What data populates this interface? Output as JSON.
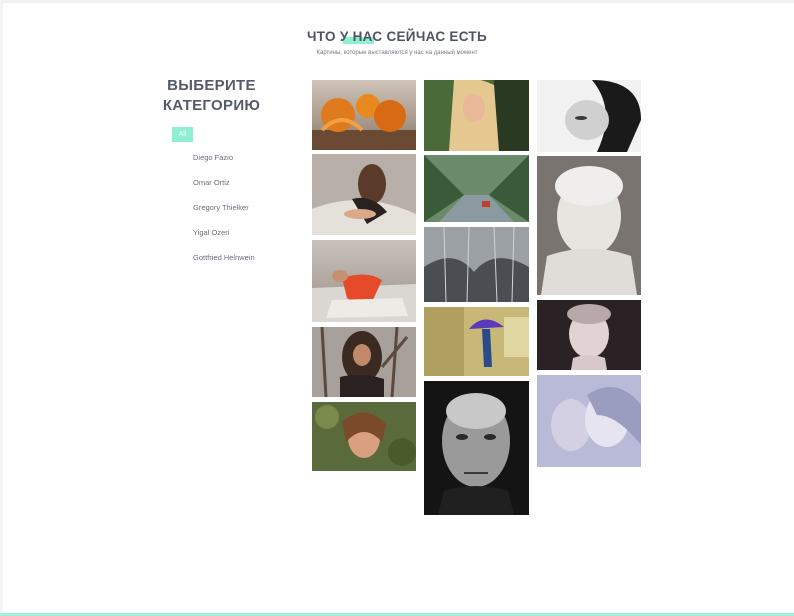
{
  "header": {
    "title": "ЧТО У НАС СЕЙЧАС ЕСТЬ",
    "subtitle": "Картины, которые выставляются у нас на данный момент"
  },
  "sidebar": {
    "heading_line1": "ВЫБЕРИТЕ",
    "heading_line2": "КАТЕГОРИЮ",
    "filter_all": "All",
    "categories": [
      {
        "label": "Diego Fazio"
      },
      {
        "label": "Omar Ortiz"
      },
      {
        "label": "Gregory Thielker"
      },
      {
        "label": "Yigal Ozeri"
      },
      {
        "label": "Gottfried Helnwein"
      }
    ]
  },
  "colors": {
    "accent": "#8ef0d0",
    "heading": "#4f5363",
    "body_text": "#6a6f7c"
  }
}
